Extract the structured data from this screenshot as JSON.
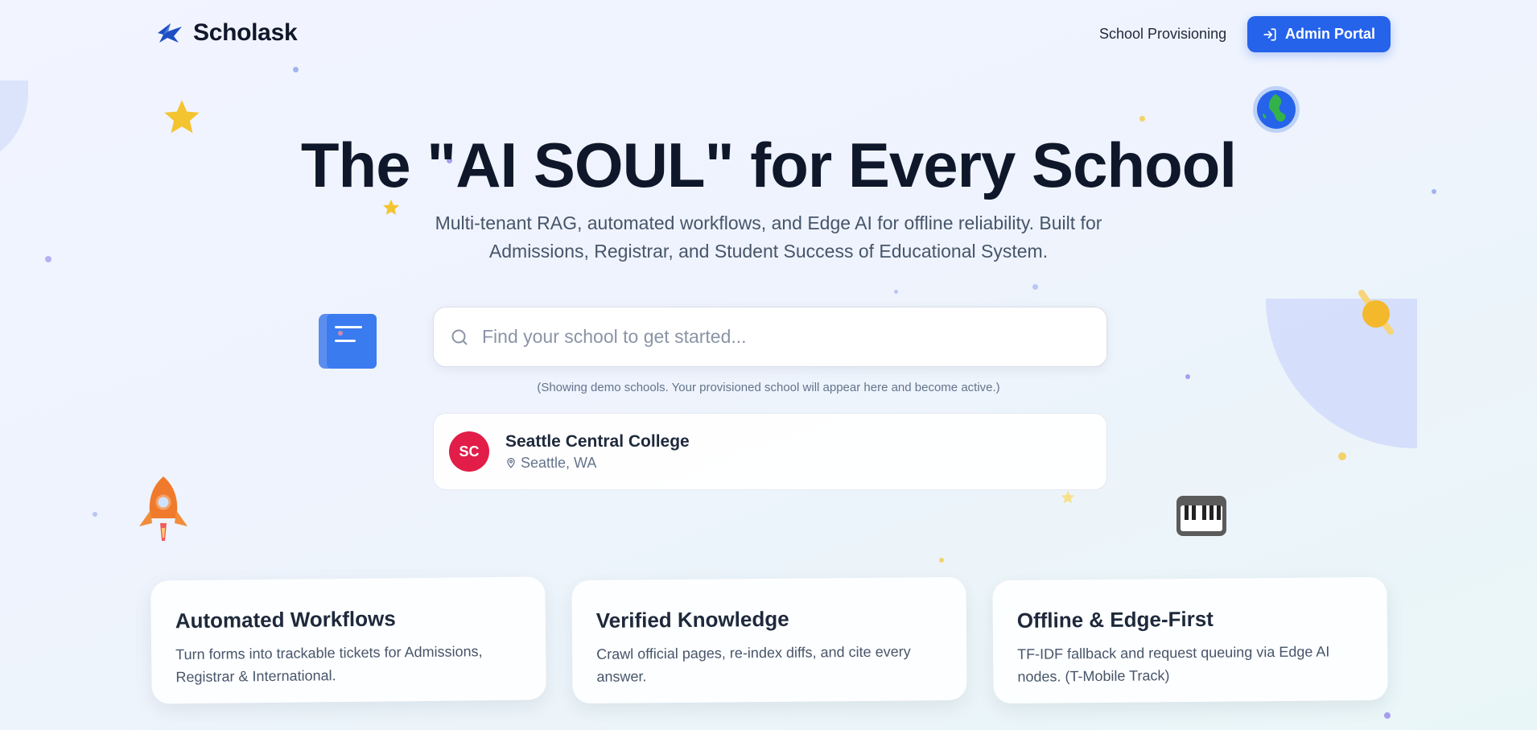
{
  "header": {
    "brand": "Scholask",
    "nav_link": "School Provisioning",
    "admin_button": "Admin Portal"
  },
  "hero": {
    "title": "The \"AI SOUL\" for Every School",
    "subtitle": "Multi-tenant RAG, automated workflows, and Edge AI for offline reliability. Built for Admissions, Registrar, and Student Success of Educational System."
  },
  "search": {
    "placeholder": "Find your school to get started...",
    "value": "",
    "note": "(Showing demo schools. Your provisioned school will appear here and become active.)"
  },
  "schools": [
    {
      "initials": "SC",
      "name": "Seattle Central College",
      "location": "Seattle, WA"
    }
  ],
  "features": [
    {
      "title": "Automated Workflows",
      "description": "Turn forms into trackable tickets for Admissions, Registrar & International."
    },
    {
      "title": "Verified Knowledge",
      "description": "Crawl official pages, re-index diffs, and cite every answer."
    },
    {
      "title": "Offline & Edge-First",
      "description": "TF-IDF fallback and request queuing via Edge AI nodes. (T-Mobile Track)"
    }
  ],
  "colors": {
    "accent": "#2563eb",
    "school_avatar": "#e11d48",
    "title": "#0f172a"
  },
  "icons": [
    "brand-logo-icon",
    "login-icon",
    "search-icon",
    "map-pin-icon",
    "star-icon",
    "globe-icon",
    "book-icon",
    "rocket-icon",
    "piano-icon",
    "planet-icon"
  ]
}
